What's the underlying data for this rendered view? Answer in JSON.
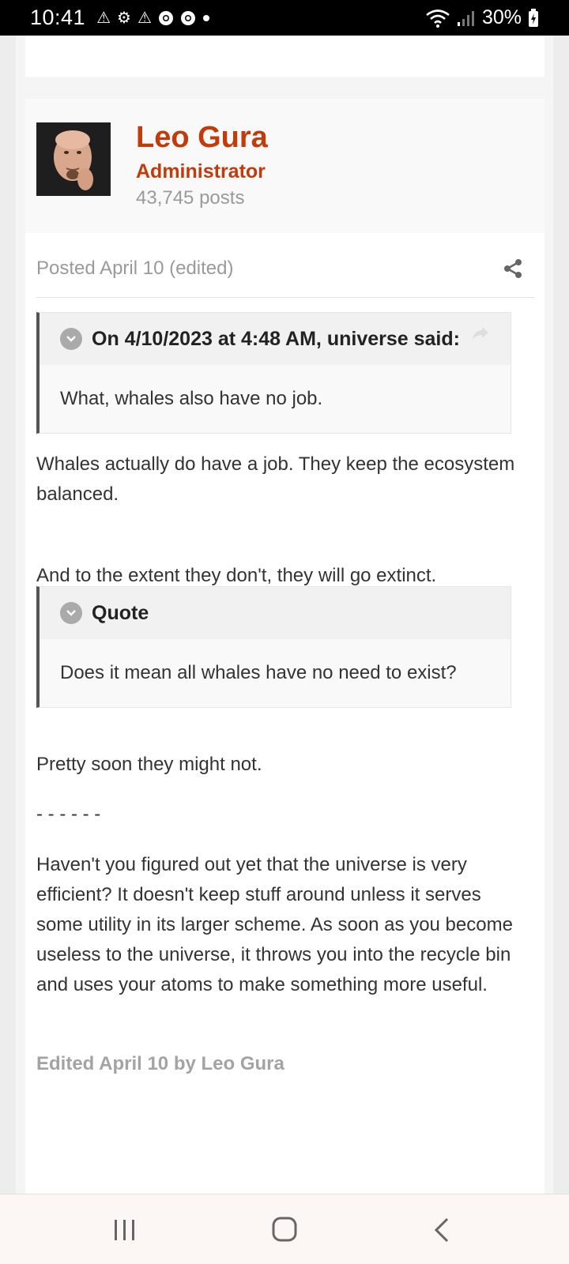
{
  "status_bar": {
    "time": "10:41",
    "notification_icons": [
      "warning-icon",
      "settings-icon",
      "warning-icon",
      "chrome-icon",
      "chrome-icon",
      "dot-icon"
    ],
    "battery": "30%"
  },
  "post": {
    "author": {
      "name": "Leo Gura",
      "role": "Administrator",
      "posts": "43,745 posts"
    },
    "posted": "Posted April 10 (edited)",
    "quote1": {
      "cite": "On 4/10/2023 at 4:48 AM, universe said:",
      "text": "What, whales also have no job."
    },
    "para1": "Whales actually do have a job. They keep the ecosystem balanced.",
    "para2": "And to the extent they don't, they will go extinct.",
    "quote2": {
      "cite": "Quote",
      "text": "Does it mean all whales have no need to exist?"
    },
    "para3": "Pretty soon they might not.",
    "separator": "- - - - - -",
    "para4": "Haven't you figured out yet that the universe is very efficient? It doesn't keep stuff around unless it serves some utility in its larger scheme. As soon as you become useless to the universe, it throws you into the recycle bin and uses your atoms to make something more useful.",
    "edited": "Edited April 10 by Leo Gura"
  },
  "colors": {
    "accent": "#c23b0a",
    "muted": "#9a9a9a"
  }
}
